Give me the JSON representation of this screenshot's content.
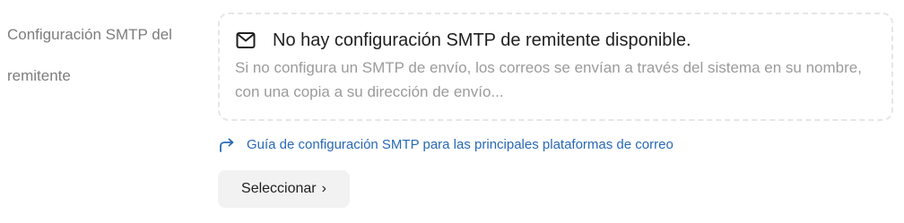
{
  "field": {
    "label": "Configuración SMTP del remitente"
  },
  "notice": {
    "icon": "mail-icon",
    "title": "No hay configuración SMTP de remitente disponible.",
    "description": "Si no configura un SMTP de envío, los correos se envían a través del sistema en su nombre, con una copia a su dirección de envío..."
  },
  "guide": {
    "icon": "share-arrow-icon",
    "label": "Guía de configuración SMTP para las principales plataformas de correo"
  },
  "select_button": {
    "label": "Seleccionar",
    "chevron": "›"
  },
  "colors": {
    "link": "#2869b6",
    "muted_text": "#9b9b9b",
    "label_text": "#7d7d7d",
    "button_bg": "#f2f2f2",
    "dashed_border": "#e6e6e6"
  }
}
